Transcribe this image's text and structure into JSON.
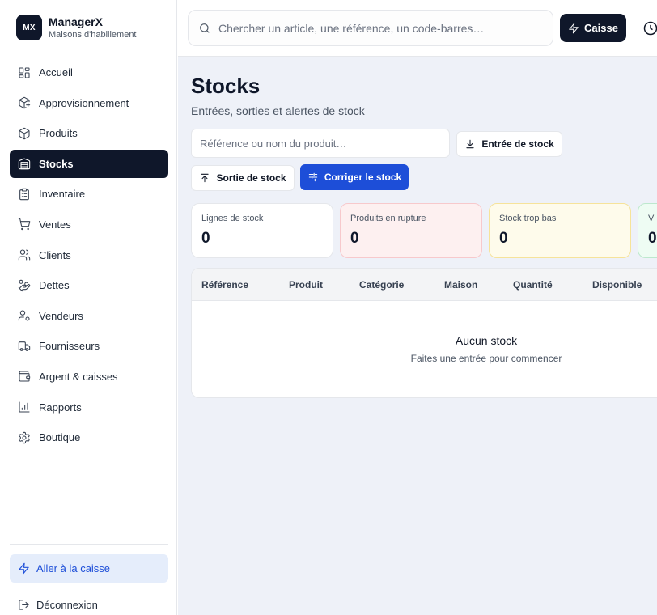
{
  "brand": {
    "logo": "MX",
    "name": "ManagerX",
    "subtitle": "Maisons d'habillement"
  },
  "sidebar": {
    "items": [
      {
        "label": "Accueil",
        "icon": "dashboard-icon"
      },
      {
        "label": "Approvisionnement",
        "icon": "package-plus-icon"
      },
      {
        "label": "Produits",
        "icon": "box-icon"
      },
      {
        "label": "Stocks",
        "icon": "warehouse-icon",
        "active": true
      },
      {
        "label": "Inventaire",
        "icon": "clipboard-icon"
      },
      {
        "label": "Ventes",
        "icon": "cart-icon"
      },
      {
        "label": "Clients",
        "icon": "users-icon"
      },
      {
        "label": "Dettes",
        "icon": "hand-coins-icon"
      },
      {
        "label": "Vendeurs",
        "icon": "user-cog-icon"
      },
      {
        "label": "Fournisseurs",
        "icon": "truck-icon"
      },
      {
        "label": "Argent & caisses",
        "icon": "wallet-icon"
      },
      {
        "label": "Rapports",
        "icon": "bar-chart-icon"
      },
      {
        "label": "Boutique",
        "icon": "gear-icon"
      }
    ],
    "cash_link": "Aller à la caisse",
    "logout": "Déconnexion"
  },
  "topbar": {
    "search_placeholder": "Chercher un article, une référence, un code-barres…",
    "caisse_label": "Caisse"
  },
  "page": {
    "title": "Stocks",
    "subtitle": "Entrées, sorties et alertes de stock",
    "filter_placeholder": "Référence ou nom du produit…",
    "btn_entree": "Entrée de stock",
    "btn_sortie": "Sortie de stock",
    "btn_corriger": "Corriger le stock"
  },
  "stats": [
    {
      "label": "Lignes de stock",
      "value": "0"
    },
    {
      "label": "Produits en rupture",
      "value": "0"
    },
    {
      "label": "Stock trop bas",
      "value": "0"
    },
    {
      "label": "V",
      "value": "0"
    }
  ],
  "table": {
    "headers": [
      "Référence",
      "Produit",
      "Catégorie",
      "Maison",
      "Quantité",
      "Disponible"
    ],
    "empty_title": "Aucun stock",
    "empty_subtitle": "Faites une entrée pour commencer"
  },
  "colors": {
    "sidebar_active": "#0f172a",
    "primary": "#1d4ed8",
    "main_bg": "#eef1f8"
  }
}
